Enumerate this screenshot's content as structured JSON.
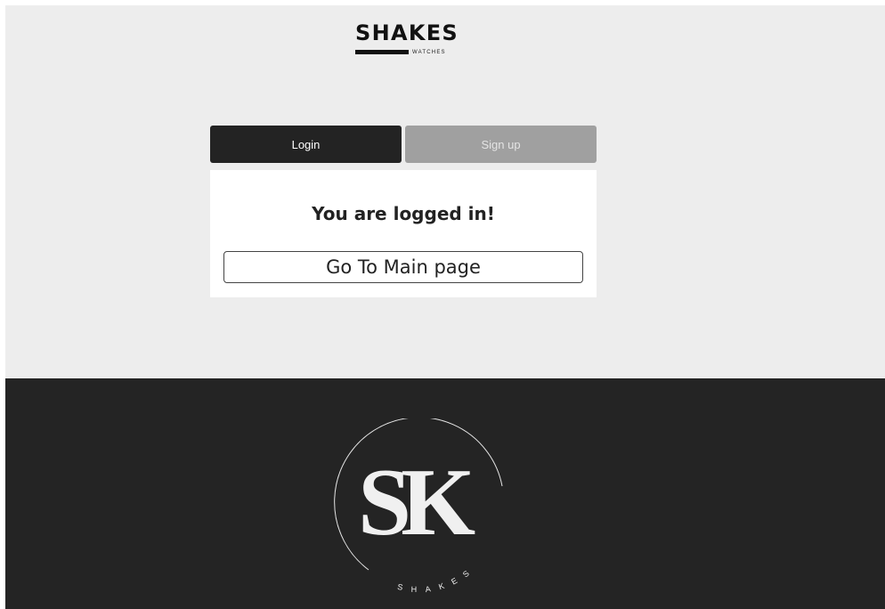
{
  "brand": {
    "name": "SHAKES",
    "subtitle": "WATCHES"
  },
  "tabs": [
    {
      "label": "Login",
      "active": true
    },
    {
      "label": "Sign up",
      "active": false
    }
  ],
  "status": {
    "message": "You are logged in!"
  },
  "actions": {
    "main_page_label": "Go To Main page"
  },
  "footer": {
    "logo_monogram": "SK",
    "logo_text": "SHAKES"
  },
  "colors": {
    "page_bg": "#ededed",
    "footer_bg": "#242424",
    "active_tab": "#232323",
    "inactive_tab": "#a0a0a0"
  }
}
